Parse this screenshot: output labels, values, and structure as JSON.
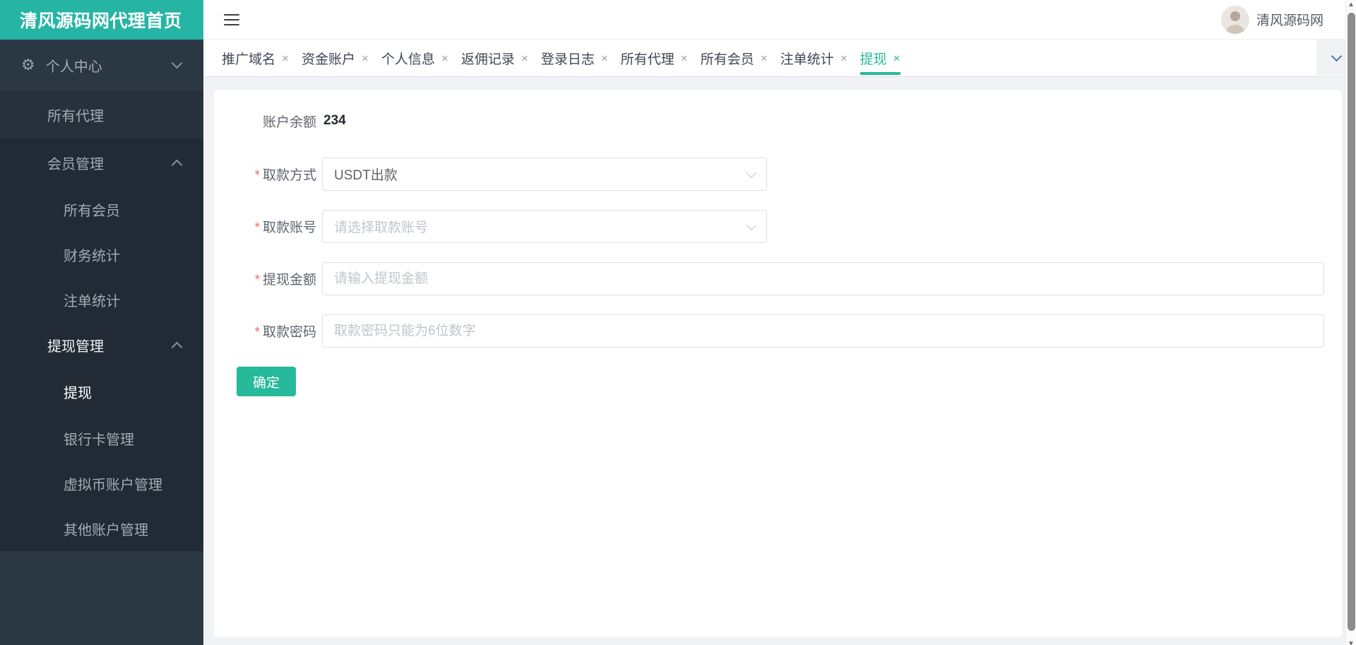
{
  "app": {
    "logo_title": "清风源码网代理首页"
  },
  "header": {
    "username": "清风源码网"
  },
  "sidebar": {
    "items": [
      {
        "label": "个人中心",
        "level": 0,
        "icon": "gear",
        "chevron": "down",
        "active": false
      },
      {
        "label": "所有代理",
        "level": 1,
        "active": false
      },
      {
        "label": "会员管理",
        "level": 1,
        "chevron": "up",
        "active": false
      },
      {
        "label": "所有会员",
        "level": 2,
        "active": false
      },
      {
        "label": "财务统计",
        "level": 2,
        "active": false
      },
      {
        "label": "注单统计",
        "level": 2,
        "active": false
      },
      {
        "label": "提现管理",
        "level": 1,
        "chevron": "up",
        "active": true
      },
      {
        "label": "提现",
        "level": 2,
        "active": true
      },
      {
        "label": "银行卡管理",
        "level": 2,
        "active": false
      },
      {
        "label": "虚拟币账户管理",
        "level": 2,
        "active": false
      },
      {
        "label": "其他账户管理",
        "level": 2,
        "active": false
      }
    ]
  },
  "tabs": [
    {
      "label": "推广域名",
      "active": false
    },
    {
      "label": "资金账户",
      "active": false
    },
    {
      "label": "个人信息",
      "active": false
    },
    {
      "label": "返佣记录",
      "active": false
    },
    {
      "label": "登录日志",
      "active": false
    },
    {
      "label": "所有代理",
      "active": false
    },
    {
      "label": "所有会员",
      "active": false
    },
    {
      "label": "注单统计",
      "active": false
    },
    {
      "label": "提现",
      "active": true
    }
  ],
  "form": {
    "balance_label": "账户余额",
    "balance_value": "234",
    "fields": [
      {
        "label": "取款方式",
        "type": "select",
        "value": "USDT出款",
        "required": true
      },
      {
        "label": "取款账号",
        "type": "select",
        "placeholder": "请选择取款账号",
        "required": true
      },
      {
        "label": "提现金额",
        "type": "input",
        "placeholder": "请输入提现金额",
        "required": true
      },
      {
        "label": "取款密码",
        "type": "input",
        "placeholder": "取款密码只能为6位数字",
        "required": true
      }
    ],
    "required_mark": "*",
    "submit_label": "确定"
  },
  "icons": {
    "close": "×",
    "gear": "⚙",
    "scroll_up": "▲",
    "scroll_down": "▼"
  },
  "colors": {
    "accent": "#26b99a",
    "logo_bg": "#26b4a4",
    "sidebar_bg": "#2c3744",
    "sidebar_submenu_bg": "#222b35",
    "content_bg": "#f0f2f5",
    "required": "#f56c6c"
  }
}
